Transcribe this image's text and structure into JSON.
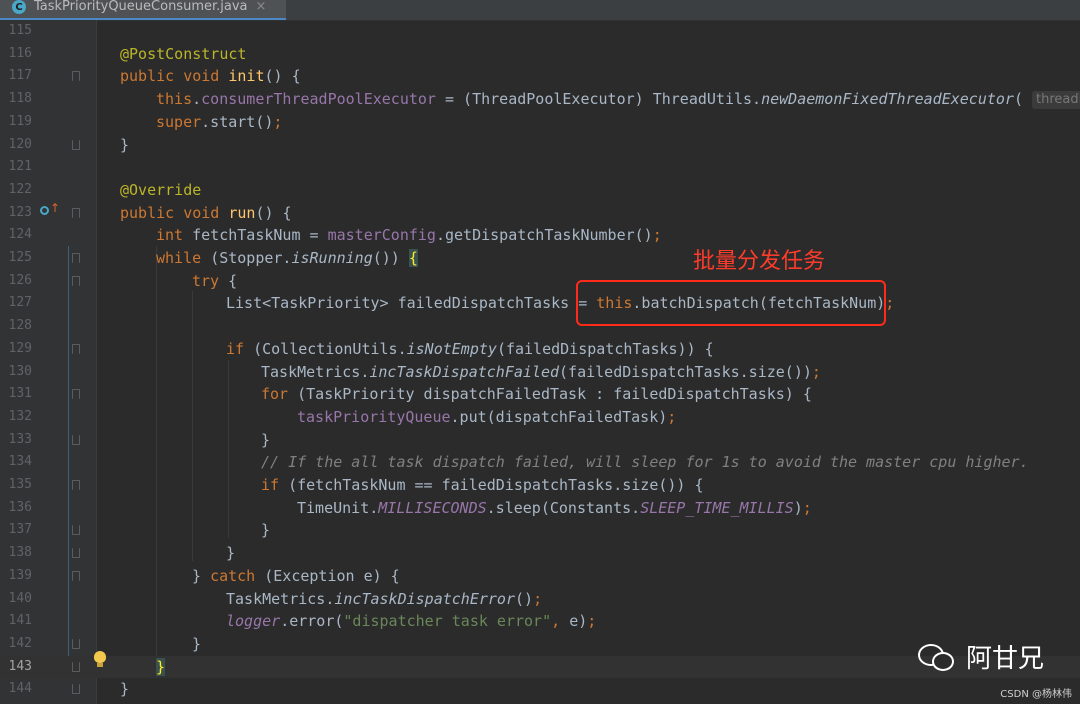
{
  "tab": {
    "icon_letter": "C",
    "filename": "TaskPriorityQueueConsumer.java",
    "close": "×"
  },
  "lines": [
    {
      "n": "115"
    },
    {
      "n": "116"
    },
    {
      "n": "117"
    },
    {
      "n": "118"
    },
    {
      "n": "119"
    },
    {
      "n": "120"
    },
    {
      "n": "121"
    },
    {
      "n": "122"
    },
    {
      "n": "123"
    },
    {
      "n": "124"
    },
    {
      "n": "125"
    },
    {
      "n": "126"
    },
    {
      "n": "127"
    },
    {
      "n": "128"
    },
    {
      "n": "129"
    },
    {
      "n": "130"
    },
    {
      "n": "131"
    },
    {
      "n": "132"
    },
    {
      "n": "133"
    },
    {
      "n": "134"
    },
    {
      "n": "135"
    },
    {
      "n": "136"
    },
    {
      "n": "137"
    },
    {
      "n": "138"
    },
    {
      "n": "139"
    },
    {
      "n": "140"
    },
    {
      "n": "141"
    },
    {
      "n": "142"
    },
    {
      "n": "143"
    },
    {
      "n": "144"
    }
  ],
  "code": {
    "l116_ann": "@PostConstruct",
    "l117_kw": "public void ",
    "l117_fn": "init",
    "l117_rest": "() {",
    "l118_this": "this",
    "l118_dot": ".",
    "l118_field": "consumerThreadPoolExecutor",
    "l118_mid": " = (ThreadPoolExecutor) ThreadUtils.",
    "l118_call": "newDaemonFixedThreadExecutor",
    "l118_paren": "( ",
    "l118_hint": "threadName",
    "l119_kw": "super",
    "l119_rest": ".start()",
    "l119_semi": ";",
    "l120": "}",
    "l122_ann": "@Override",
    "l123_kw": "public void ",
    "l123_fn": "run",
    "l123_rest": "() {",
    "l124_kw": "int ",
    "l124_a": "fetchTaskNum = ",
    "l124_field": "masterConfig",
    "l124_b": ".getDispatchTaskNumber()",
    "l124_semi": ";",
    "l125_kw": "while ",
    "l125_a": "(Stopper.",
    "l125_call": "isRunning",
    "l125_b": "()) ",
    "l125_brace": "{",
    "l126_kw": "try ",
    "l126_b": "{",
    "l127_a": "List<TaskPriority> failedDispatchTasks = ",
    "l127_this": "this",
    "l127_b": ".batchDispatch(fetchTaskNum)",
    "l127_semi": ";",
    "l129_kw": "if ",
    "l129_a": "(CollectionUtils.",
    "l129_call": "isNotEmpty",
    "l129_b": "(failedDispatchTasks)) {",
    "l130_a": "TaskMetrics.",
    "l130_call": "incTaskDispatchFailed",
    "l130_b": "(failedDispatchTasks.size())",
    "l130_semi": ";",
    "l131_kw": "for ",
    "l131_a": "(TaskPriority dispatchFailedTask : failedDispatchTasks) {",
    "l132_field": "taskPriorityQueue",
    "l132_a": ".put(dispatchFailedTask)",
    "l132_semi": ";",
    "l133": "}",
    "l134_comment": "// If the all task dispatch failed, will sleep for 1s to avoid the master cpu higher.",
    "l135_kw": "if ",
    "l135_a": "(fetchTaskNum == failedDispatchTasks.size()) {",
    "l136_a": "TimeUnit.",
    "l136_st": "MILLISECONDS",
    "l136_b": ".sleep(Constants.",
    "l136_st2": "SLEEP_TIME_MILLIS",
    "l136_c": ")",
    "l136_semi": ";",
    "l137": "}",
    "l138": "}",
    "l139_a": "} ",
    "l139_kw": "catch ",
    "l139_b": "(Exception e) {",
    "l140_a": "TaskMetrics.",
    "l140_call": "incTaskDispatchError",
    "l140_b": "()",
    "l140_semi": ";",
    "l141_field": "logger",
    "l141_a": ".error(",
    "l141_str": "\"dispatcher task error\"",
    "l141_comma": ", ",
    "l141_b": "e)",
    "l141_semi": ";",
    "l142": "}",
    "l143": "}",
    "l144": "}"
  },
  "annotation": {
    "label": "批量分发任务",
    "color": "#ff2a1a"
  },
  "watermark": {
    "name": "阿甘兄",
    "credit": "CSDN @杨林伟"
  },
  "colors": {
    "background": "#2b2b2b",
    "keyword": "#cc7832",
    "function": "#ffc66d",
    "field": "#9876aa",
    "string": "#6a8759"
  }
}
